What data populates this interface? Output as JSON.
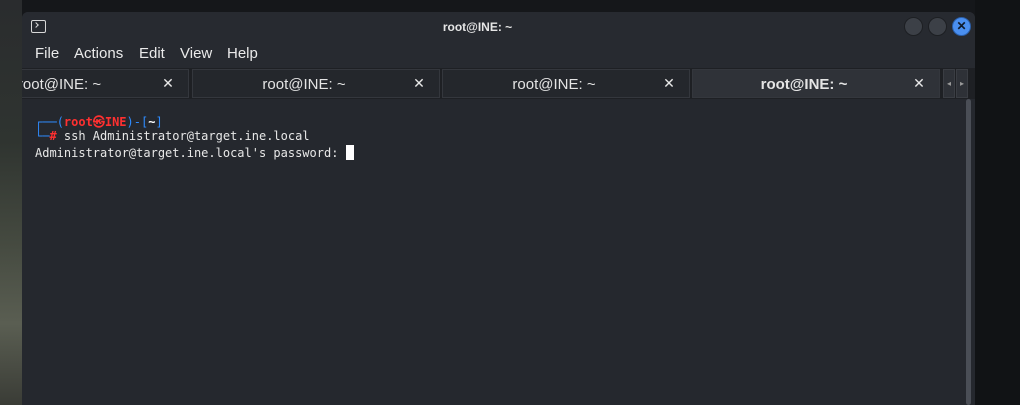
{
  "window": {
    "title": "root@INE: ~"
  },
  "menu": [
    "File",
    "Actions",
    "Edit",
    "View",
    "Help"
  ],
  "tabs": [
    {
      "label": "root@INE: ~",
      "close": "✕"
    },
    {
      "label": "root@INE: ~",
      "close": "✕"
    },
    {
      "label": "root@INE: ~",
      "close": "✕"
    },
    {
      "label": "root@INE: ~",
      "close": "✕"
    }
  ],
  "tab_scroll": {
    "left": "◂",
    "right": "▸"
  },
  "terminal": {
    "prompt_corner_top": "┌──",
    "prompt_open": "(",
    "prompt_user": "root",
    "prompt_at": "㉿",
    "prompt_host": "INE",
    "prompt_close": ")",
    "prompt_dash": "-",
    "prompt_dir_open": "[",
    "prompt_dir": "~",
    "prompt_dir_close": "]",
    "prompt_corner_bottom": "└─",
    "prompt_hash": "#",
    "command": " ssh Administrator@target.ine.local",
    "output": "Administrator@target.ine.local's password: "
  },
  "colors": {
    "prompt_frame": "#2f8cff",
    "prompt_user": "#ff3030",
    "close_button": "#4a8ff0"
  }
}
